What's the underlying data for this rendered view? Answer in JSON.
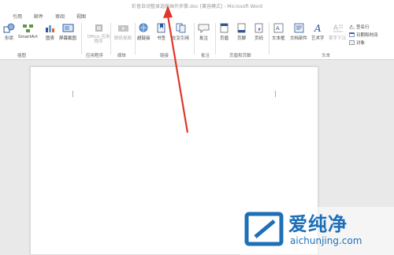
{
  "window": {
    "title": "彩普自动整录选版画作步骤.doc [兼容模式] - Microsoft Word"
  },
  "tabs": [
    "引用",
    "邮件",
    "审阅",
    "视图"
  ],
  "ribbon": {
    "commands": {
      "shapes": "形状",
      "smartart": "SmartArt",
      "chart": "图表",
      "screenshot": "屏幕截图",
      "office_apps": "Office 应用程序",
      "online_video": "联机视频",
      "hyperlink": "超链接",
      "bookmark": "书签",
      "cross_ref": "交叉引用",
      "comment": "批注",
      "header": "页眉",
      "footer": "页脚",
      "page_number": "页码",
      "textbox": "文本框",
      "doc_parts": "文档部件",
      "wordart": "艺术字",
      "dropcap": "首字下沉",
      "signature_line": "签名行",
      "date_time": "日期和时间",
      "object": "对象"
    },
    "groups": {
      "illustrations": "插图",
      "apps": "应用程序",
      "media": "媒体",
      "links": "链接",
      "comments": "批注",
      "header_footer": "页眉和页脚",
      "text": "文本"
    }
  },
  "watermark": {
    "brand": "爱纯净",
    "url": "aichunjing.com"
  },
  "colors": {
    "accent_blue": "#2b579a",
    "arrow_red": "#e0362b",
    "watermark_blue": "#1d6fb7"
  }
}
